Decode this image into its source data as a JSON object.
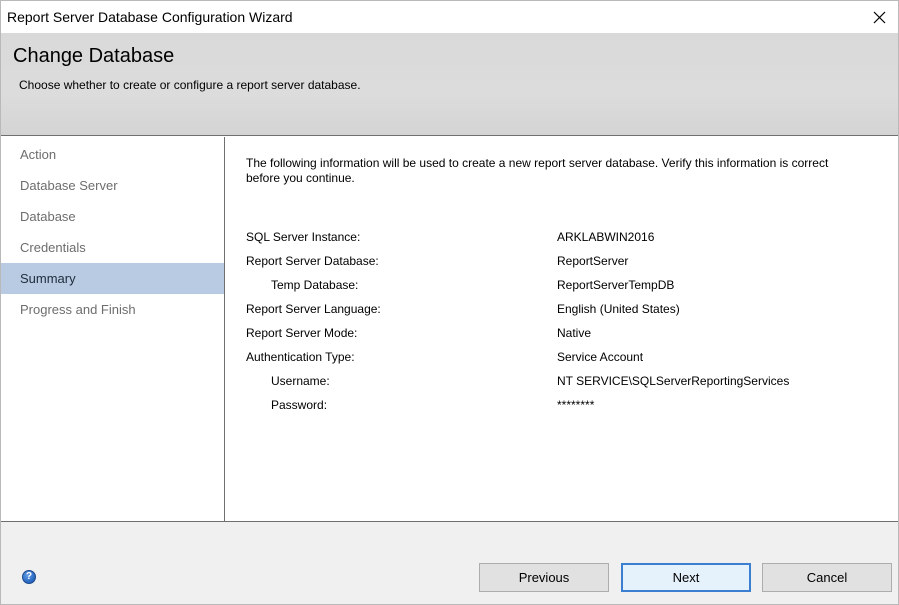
{
  "window": {
    "title": "Report Server Database Configuration Wizard"
  },
  "header": {
    "title": "Change Database",
    "subtitle": "Choose whether to create or configure a report server database."
  },
  "sidebar": {
    "items": [
      {
        "label": "Action"
      },
      {
        "label": "Database Server"
      },
      {
        "label": "Database"
      },
      {
        "label": "Credentials"
      },
      {
        "label": "Summary",
        "active": true
      },
      {
        "label": "Progress and Finish"
      }
    ]
  },
  "summary": {
    "intro": "The following information will be used to create a new report server database. Verify this information is correct before you continue.",
    "rows": [
      {
        "label": "SQL Server Instance:",
        "value": "ARKLABWIN2016"
      },
      {
        "label": "Report Server Database:",
        "value": "ReportServer"
      },
      {
        "label": "Temp Database:",
        "value": "ReportServerTempDB"
      },
      {
        "label": "Report Server Language:",
        "value": "English (United States)"
      },
      {
        "label": "Report Server Mode:",
        "value": "Native"
      },
      {
        "label": "Authentication Type:",
        "value": "Service Account"
      },
      {
        "label": "Username:",
        "value": "NT SERVICE\\SQLServerReportingServices"
      },
      {
        "label": "Password:",
        "value": "********"
      }
    ]
  },
  "footer": {
    "help_icon": "?",
    "previous_label": "Previous",
    "next_label": "Next",
    "cancel_label": "Cancel"
  },
  "colors": {
    "selected_nav": "#b9cbe3",
    "header_bg": "#d9d9d9",
    "default_button_border": "#3c7fd0"
  }
}
